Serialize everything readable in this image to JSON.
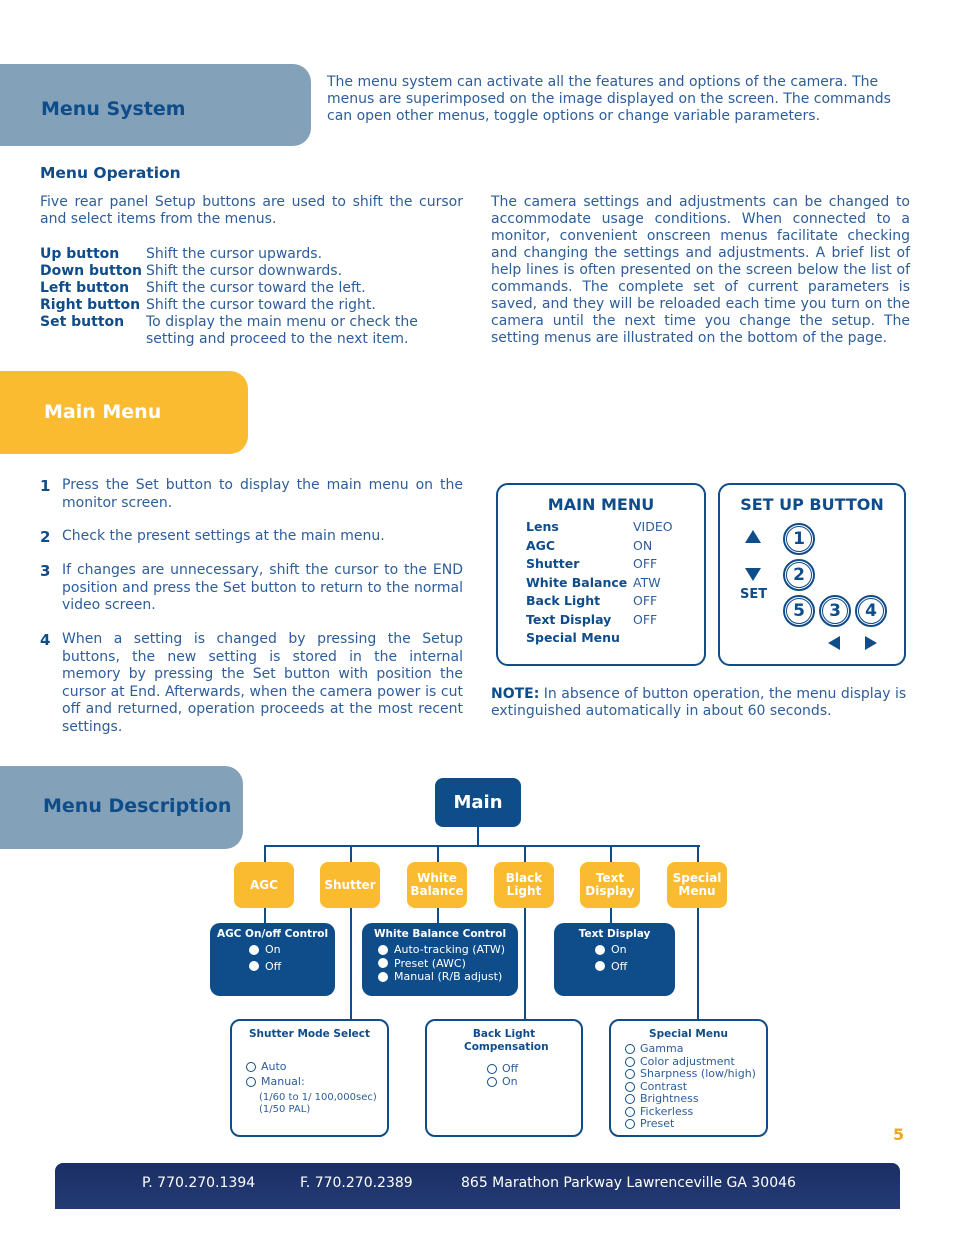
{
  "menu_system": {
    "title": "Menu System",
    "intro": "The menu system can activate all the features and options of the camera. The menus are superimposed on the image displayed on the screen. The commands can open other menus, toggle options or change variable parameters."
  },
  "menu_operation": {
    "heading": "Menu Operation",
    "intro": "Five rear panel Setup buttons are used to shift the cursor and select items from the menus.",
    "buttons": [
      {
        "name": "Up button",
        "desc": "Shift the cursor upwards."
      },
      {
        "name": "Down button",
        "desc": "Shift the cursor downwards."
      },
      {
        "name": "Left button",
        "desc": "Shift the cursor toward the left."
      },
      {
        "name": "Right button",
        "desc": "Shift the cursor toward the right."
      },
      {
        "name": "Set button",
        "desc": "To display the main menu or check the setting and proceed to the next item."
      }
    ],
    "right_paragraph": "The camera settings and adjustments can be changed to accommodate usage conditions. When connected to a monitor, convenient onscreen menus facilitate checking and changing the settings and adjustments. A brief list of help lines is often presented on the screen below the list of commands. The complete set of current parameters is saved, and they will be reloaded each time you turn on the camera until the next time you change the setup. The setting menus are illustrated on the bottom of the page."
  },
  "main_menu_section": {
    "title": "Main Menu",
    "steps": [
      {
        "num": "1",
        "text": "Press the Set button to display the main menu on the monitor screen."
      },
      {
        "num": "2",
        "text": "Check the present settings at the main menu."
      },
      {
        "num": "3",
        "text": "If changes are unnecessary, shift the cursor to the END position and press the Set button to return to the normal video screen."
      },
      {
        "num": "4",
        "text": "When a setting is changed by pressing the Setup buttons, the new setting is stored in the internal memory by pressing the Set button with position the cursor at End. Afterwards, when the camera power is cut off and returned, operation proceeds at the most recent settings."
      }
    ],
    "main_menu_panel": {
      "title": "MAIN MENU",
      "rows": [
        {
          "label": "Lens",
          "value": "VIDEO"
        },
        {
          "label": "AGC",
          "value": "ON"
        },
        {
          "label": "Shutter",
          "value": "OFF"
        },
        {
          "label": "White Balance",
          "value": "ATW"
        },
        {
          "label": "Back Light",
          "value": "OFF"
        },
        {
          "label": "Text Display",
          "value": "OFF"
        },
        {
          "label": "Special Menu",
          "value": ""
        }
      ]
    },
    "setup_panel": {
      "title": "SET UP BUTTON",
      "set_label": "SET",
      "buttons": [
        "1",
        "2",
        "5",
        "3",
        "4"
      ]
    },
    "note_label": "NOTE:",
    "note_text": " In absence of button operation, the menu display is extinguished automatically in about 60 seconds."
  },
  "menu_description": {
    "title": "Menu Description",
    "root": "Main",
    "categories": [
      "AGC",
      "Shutter",
      "White Balance",
      "Black Light",
      "Text Display",
      "Special Menu"
    ],
    "agc_box": {
      "title": "AGC On/off Control",
      "options": [
        "On",
        "Off"
      ]
    },
    "wb_box": {
      "title": "White Balance Control",
      "options": [
        "Auto-tracking (ATW)",
        "Preset (AWC)",
        "Manual (R/B adjust)"
      ]
    },
    "text_box": {
      "title": "Text Display",
      "options": [
        "On",
        "Off"
      ]
    },
    "shutter_box": {
      "title": "Shutter Mode Select",
      "options": [
        "Auto",
        "Manual:"
      ],
      "notes": [
        "(1/60  to 1/ 100,000sec)",
        "(1/50 PAL)"
      ]
    },
    "backlight_box": {
      "title": "Back Light Compensation",
      "options": [
        "Off",
        "On"
      ]
    },
    "special_box": {
      "title": "Special Menu",
      "options": [
        "Gamma",
        "Color adjustment",
        "Sharpness (low/high)",
        "Contrast",
        "Brightness",
        "Fickerless",
        "Preset"
      ]
    }
  },
  "page_number": "5",
  "footer": {
    "phone": "P. 770.270.1394",
    "fax": "F. 770.270.2389",
    "address": "865 Marathon Parkway Lawrenceville GA 30046"
  },
  "colors": {
    "navy": "#0f4c8a",
    "steel_blue": "#83a2b9",
    "amber": "#fbbb30",
    "footer": "#1b2f66"
  }
}
